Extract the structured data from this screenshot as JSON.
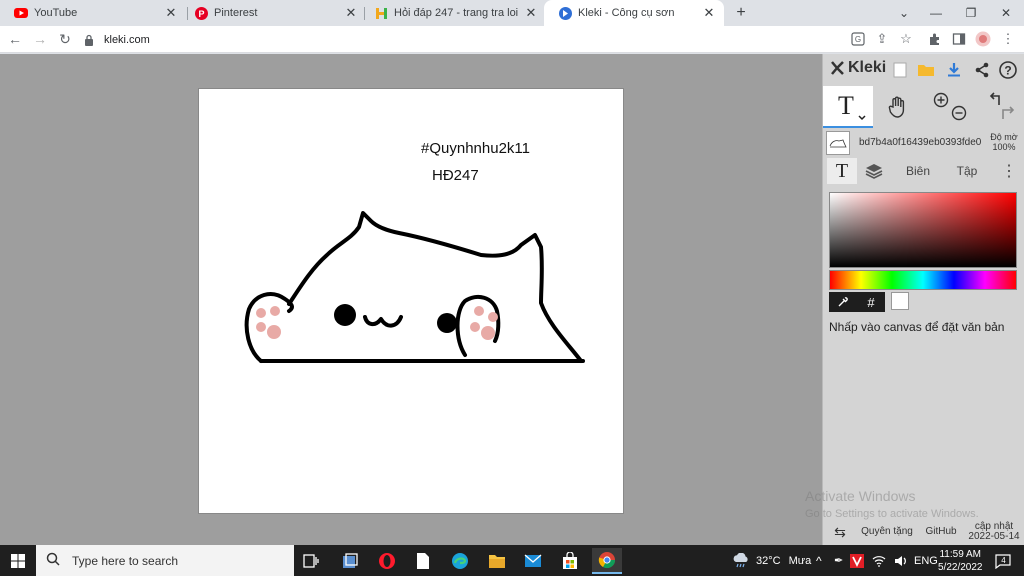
{
  "browser": {
    "tabs": [
      {
        "label": "YouTube",
        "active": false
      },
      {
        "label": "Pinterest",
        "active": false
      },
      {
        "label": "Hỏi đáp 247 - trang tra loi",
        "active": false
      },
      {
        "label": "Kleki - Công cụ sơn",
        "active": true
      }
    ],
    "url": "kleki.com"
  },
  "canvas": {
    "text_line1": "#Quynhnhu2k11",
    "text_line2": "HĐ247"
  },
  "kleki": {
    "logo": "Kleki",
    "layer_name": "bd7b4a0f16439eb0393fde0",
    "opacity_label": "Độ mờ",
    "opacity_value": "100%",
    "tabs": {
      "edit": "Biên",
      "file": "Tập"
    },
    "hint": "Nhấp vào canvas để đặt văn bản",
    "hex_symbol": "#",
    "footer": {
      "donate": "Quyên tặng",
      "github": "GitHub",
      "update_label": "cập nhật",
      "update_date": "2022-05-14"
    },
    "watermark": {
      "title": "Activate Windows",
      "subtitle": "Go to Settings to activate Windows."
    },
    "colors": {
      "accent": "#3b8fe0",
      "panel": "#d4d4d4"
    }
  },
  "taskbar": {
    "search_placeholder": "Type here to search",
    "weather": "32°C",
    "weather_desc": "Mưa",
    "language": "ENG",
    "time": "11:59 AM",
    "date": "5/22/2022",
    "notifications": "4"
  }
}
